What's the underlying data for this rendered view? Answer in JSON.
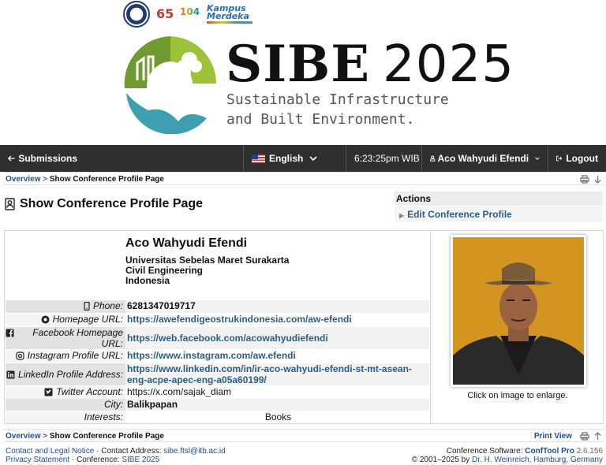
{
  "banner": {
    "logo_kampus_line1": "Kampus",
    "logo_kampus_line2": "Merdeka",
    "logo_65": "65",
    "logo_104": "104",
    "title_main": "SIBE",
    "title_year": "2025",
    "subtitle_line1": "Sustainable Infrastructure",
    "subtitle_line2": "and Built Environment."
  },
  "nav": {
    "submissions": "Submissions",
    "language": "English",
    "time": "6:23:25pm WIB",
    "user": "Aco Wahyudi Efendi",
    "logout": "Logout"
  },
  "breadcrumb": {
    "overview": "Overview",
    "separator": ">",
    "current": "Show Conference Profile Page",
    "print_view": "Print View"
  },
  "page": {
    "title": "Show Conference Profile Page"
  },
  "actions": {
    "header": "Actions",
    "edit": "Edit Conference Profile"
  },
  "profile": {
    "name": "Aco Wahyudi Efendi",
    "affiliation": [
      "Universitas Sebelas Maret Surakarta",
      "Civil Engineering",
      "Indonesia"
    ],
    "photo_caption": "Click on image to enlarge.",
    "fields": [
      {
        "label": "Phone:",
        "icon": "phone-icon",
        "value": "6281347019717"
      },
      {
        "label": "Homepage URL:",
        "icon": "chrome-icon",
        "value": "https://awefendigeostrukindonesia.com/aw-efendi"
      },
      {
        "label": "Facebook Homepage URL:",
        "icon": "facebook-icon",
        "value": "https://web.facebook.com/acowahyudiefendi"
      },
      {
        "label": "Instagram Profile URL:",
        "icon": "instagram-icon",
        "value": "https://www.instagram.com/aw.efendi"
      },
      {
        "label": "LinkedIn Profile Address:",
        "icon": "linkedin-icon",
        "value": "https://www.linkedin.com/in/ir-aco-wahyudi-efendi-st-mt-asean-eng-acpe-apec-eng-a05a60199/"
      },
      {
        "label": "Twitter Account:",
        "icon": "twitter-icon",
        "value": "https://x.com/sajak_diam"
      },
      {
        "label": "City:",
        "value": "Balikpapan"
      },
      {
        "label": "Interests:",
        "value": "Books"
      }
    ]
  },
  "footer": {
    "contact_legal": "Contact and Legal Notice",
    "contact_address_label": "Contact Address:",
    "contact_email": "sibe.ftsl@itb.ac.id",
    "privacy": "Privacy Statement",
    "conference_label": "Conference:",
    "conference": "SIBE 2025",
    "software_label": "Conference Software:",
    "software": "ConfTool Pro",
    "version": "2.6.156",
    "copyright": "© 2001–2025 by",
    "author": "Dr. H. Weinreich, Hamburg, Germany"
  },
  "colors": {
    "nav_bg": "#2f2f2f",
    "link": "#2d5d84",
    "photo_bg": "#d79a22"
  }
}
